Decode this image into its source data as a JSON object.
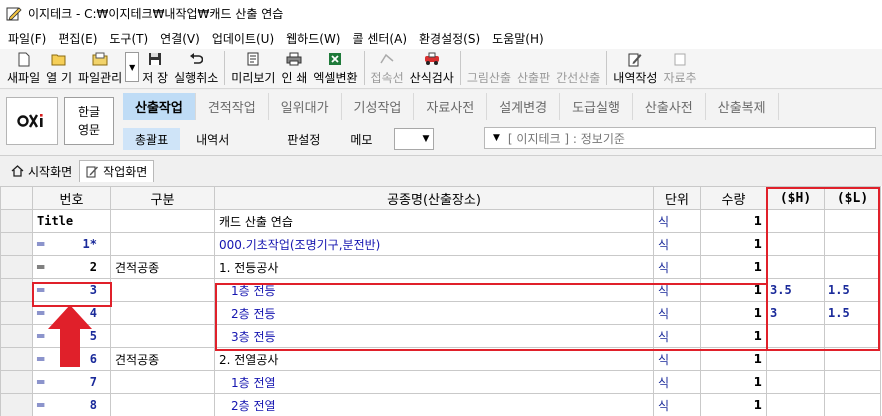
{
  "window": {
    "title": "이지테크 - C:₩이지테크₩내작업₩캐드 산출 연습"
  },
  "menu": [
    "파일(F)",
    "편집(E)",
    "도구(T)",
    "연결(V)",
    "업데이트(U)",
    "웹하드(W)",
    "콜 센터(A)",
    "환경설정(S)",
    "도움말(H)"
  ],
  "toolbar": {
    "new": "새파일",
    "open": "열 기",
    "file_manage": "파일관리",
    "save": "저 장",
    "undo": "실행취소",
    "preview": "미리보기",
    "print": "인 쇄",
    "excel": "엑셀변환",
    "connect": "접속선",
    "calc_check": "산식검사",
    "draw_calc": "그림산출",
    "calc_board": "산출판",
    "line_calc": "간선산출",
    "detail": "내역작성",
    "material": "자료추"
  },
  "panel": {
    "lang_ko": "한글",
    "lang_en": "영문",
    "tabs": [
      "산출작업",
      "견적작업",
      "일위대가",
      "기성작업",
      "자료사전",
      "설계변경",
      "도급실행",
      "산출사전",
      "산출복제"
    ],
    "active_tab": "산출작업",
    "subbuttons": [
      "총괄표",
      "내역서",
      "판설정",
      "메모"
    ],
    "standard": "[ 이지테크 ] : 정보기준"
  },
  "doc_tabs": [
    "시작화면",
    "작업화면"
  ],
  "grid": {
    "headers": [
      "번호",
      "구분",
      "공종명(산출장소)",
      "단위",
      "수량",
      "($H)",
      "($L)"
    ],
    "rows": [
      {
        "marker": "",
        "no": "Title",
        "kind": "",
        "name": "캐드 산출 연습",
        "unit": "식",
        "qty": "1",
        "h": "",
        "l": ""
      },
      {
        "marker": "═",
        "no": "1*",
        "kind": "",
        "name": "000.기초작업(조명기구,분전반)",
        "unit": "식",
        "qty": "1",
        "h": "",
        "l": ""
      },
      {
        "marker": "═",
        "no": "2",
        "kind": "견적공종",
        "name": "1. 전등공사",
        "unit": "식",
        "qty": "1",
        "h": "",
        "l": ""
      },
      {
        "marker": "═",
        "no": "3",
        "kind": "",
        "name": "1층 전등",
        "unit": "식",
        "qty": "1",
        "h": "3.5",
        "l": "1.5"
      },
      {
        "marker": "═",
        "no": "4",
        "kind": "",
        "name": "2층 전등",
        "unit": "식",
        "qty": "1",
        "h": "3",
        "l": "1.5"
      },
      {
        "marker": "═",
        "no": "5",
        "kind": "",
        "name": "3층 전등",
        "unit": "식",
        "qty": "1",
        "h": "",
        "l": ""
      },
      {
        "marker": "═",
        "no": "6",
        "kind": "견적공종",
        "name": "2. 전열공사",
        "unit": "식",
        "qty": "1",
        "h": "",
        "l": ""
      },
      {
        "marker": "═",
        "no": "7",
        "kind": "",
        "name": "1층 전열",
        "unit": "식",
        "qty": "1",
        "h": "",
        "l": ""
      },
      {
        "marker": "═",
        "no": "8",
        "kind": "",
        "name": "2층 전열",
        "unit": "식",
        "qty": "1",
        "h": "",
        "l": ""
      }
    ]
  },
  "colors": {
    "highlight": "#e0202a",
    "active_tab": "#bfdcf6",
    "number_blue": "#1a2a9a"
  }
}
